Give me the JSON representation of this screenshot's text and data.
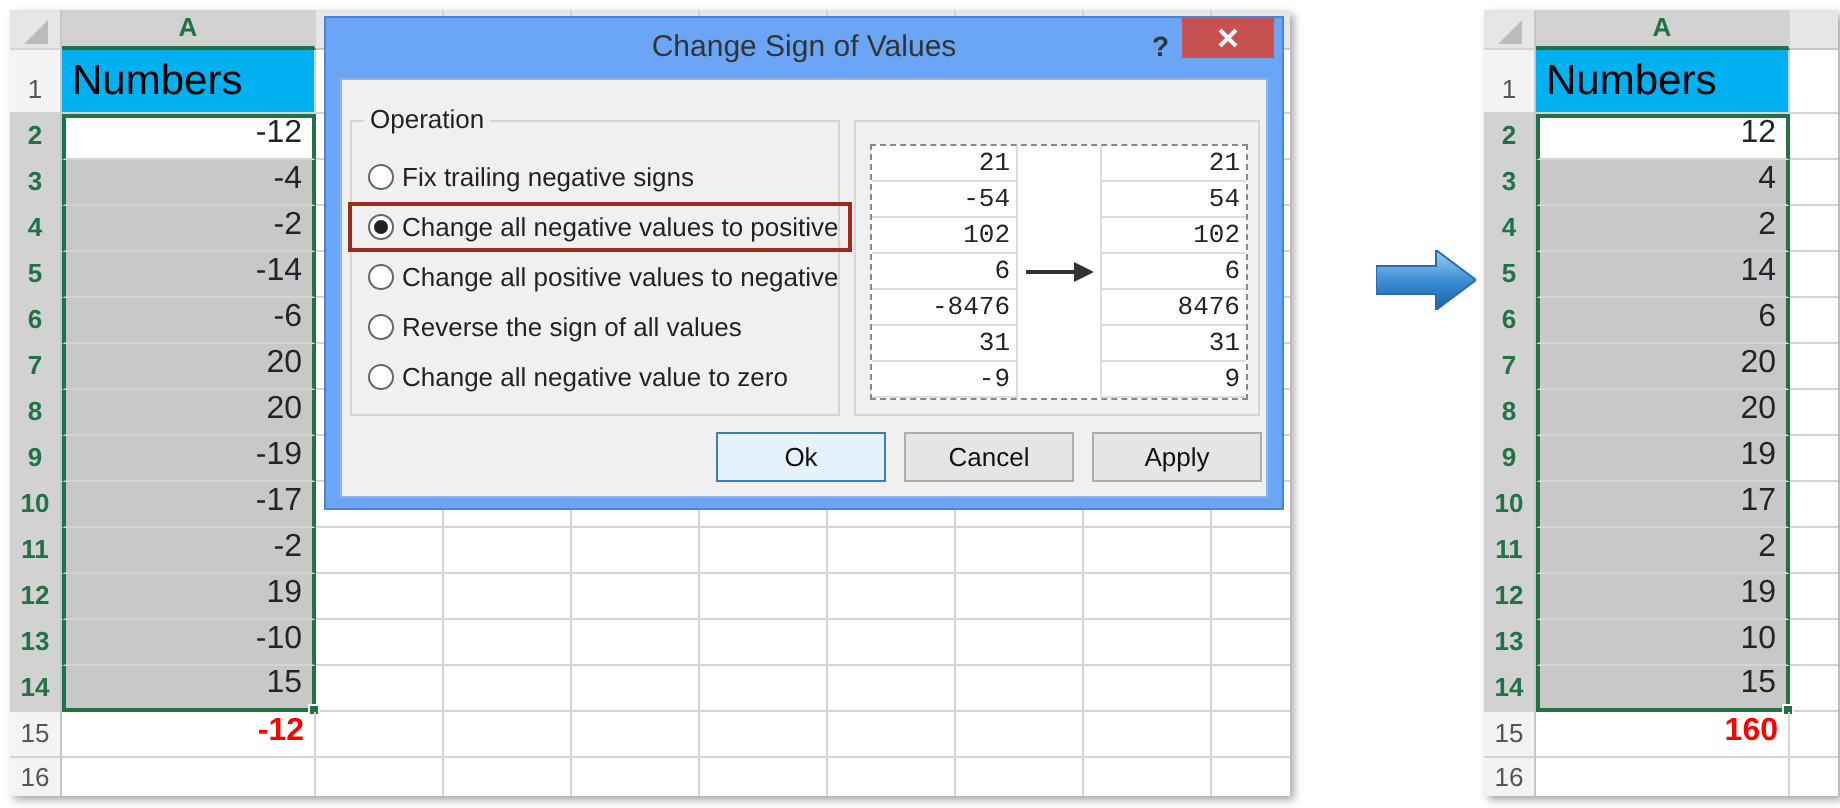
{
  "before_sheet": {
    "column": "A",
    "rows": [
      {
        "number": "1",
        "value": "Numbers",
        "kind": "header",
        "selected": false
      },
      {
        "number": "2",
        "value": "-12",
        "kind": "value",
        "selected": true,
        "active": true
      },
      {
        "number": "3",
        "value": "-4",
        "kind": "value",
        "selected": true,
        "active": false
      },
      {
        "number": "4",
        "value": "-2",
        "kind": "value",
        "selected": true,
        "active": false
      },
      {
        "number": "5",
        "value": "-14",
        "kind": "value",
        "selected": true,
        "active": false
      },
      {
        "number": "6",
        "value": "-6",
        "kind": "value",
        "selected": true,
        "active": false
      },
      {
        "number": "7",
        "value": "20",
        "kind": "value",
        "selected": true,
        "active": false
      },
      {
        "number": "8",
        "value": "20",
        "kind": "value",
        "selected": true,
        "active": false
      },
      {
        "number": "9",
        "value": "-19",
        "kind": "value",
        "selected": true,
        "active": false
      },
      {
        "number": "10",
        "value": "-17",
        "kind": "value",
        "selected": true,
        "active": false
      },
      {
        "number": "11",
        "value": "-2",
        "kind": "value",
        "selected": true,
        "active": false
      },
      {
        "number": "12",
        "value": "19",
        "kind": "value",
        "selected": true,
        "active": false
      },
      {
        "number": "13",
        "value": "-10",
        "kind": "value",
        "selected": true,
        "active": false
      },
      {
        "number": "14",
        "value": "15",
        "kind": "value",
        "selected": true,
        "active": false
      },
      {
        "number": "15",
        "value": "-12",
        "kind": "total",
        "selected": false,
        "active": false
      },
      {
        "number": "16",
        "kind": "empty",
        "selected": false
      }
    ]
  },
  "dialog": {
    "title": "Change Sign of Values",
    "help": "?",
    "group_label": "Operation",
    "options": [
      {
        "label": "Fix trailing negative signs",
        "selected": false
      },
      {
        "label": "Change all negative values to positive",
        "selected": true
      },
      {
        "label": "Change all positive values to negative",
        "selected": false
      },
      {
        "label": "Reverse the sign of all values",
        "selected": false
      },
      {
        "label": "Change all negative value to zero",
        "selected": false
      }
    ],
    "preview": {
      "before": [
        "21",
        "-54",
        "102",
        "6",
        "-8476",
        "31",
        "-9"
      ],
      "after": [
        "21",
        "54",
        "102",
        "6",
        "8476",
        "31",
        "9"
      ]
    },
    "buttons": [
      {
        "label": "Ok",
        "default": true
      },
      {
        "label": "Cancel",
        "default": false
      },
      {
        "label": "Apply",
        "default": false
      }
    ]
  },
  "after_sheet": {
    "column": "A",
    "rows": [
      {
        "number": "1",
        "value": "Numbers",
        "kind": "header",
        "selected": false
      },
      {
        "number": "2",
        "value": "12",
        "kind": "value",
        "selected": true,
        "active": true
      },
      {
        "number": "3",
        "value": "4",
        "kind": "value",
        "selected": true,
        "active": false
      },
      {
        "number": "4",
        "value": "2",
        "kind": "value",
        "selected": true,
        "active": false
      },
      {
        "number": "5",
        "value": "14",
        "kind": "value",
        "selected": true,
        "active": false
      },
      {
        "number": "6",
        "value": "6",
        "kind": "value",
        "selected": true,
        "active": false
      },
      {
        "number": "7",
        "value": "20",
        "kind": "value",
        "selected": true,
        "active": false
      },
      {
        "number": "8",
        "value": "20",
        "kind": "value",
        "selected": true,
        "active": false
      },
      {
        "number": "9",
        "value": "19",
        "kind": "value",
        "selected": true,
        "active": false
      },
      {
        "number": "10",
        "value": "17",
        "kind": "value",
        "selected": true,
        "active": false
      },
      {
        "number": "11",
        "value": "2",
        "kind": "value",
        "selected": true,
        "active": false
      },
      {
        "number": "12",
        "value": "19",
        "kind": "value",
        "selected": true,
        "active": false
      },
      {
        "number": "13",
        "value": "10",
        "kind": "value",
        "selected": true,
        "active": false
      },
      {
        "number": "14",
        "value": "15",
        "kind": "value",
        "selected": true,
        "active": false
      },
      {
        "number": "15",
        "value": "160",
        "kind": "total",
        "selected": false,
        "active": false
      },
      {
        "number": "16",
        "kind": "empty",
        "selected": false
      }
    ]
  }
}
